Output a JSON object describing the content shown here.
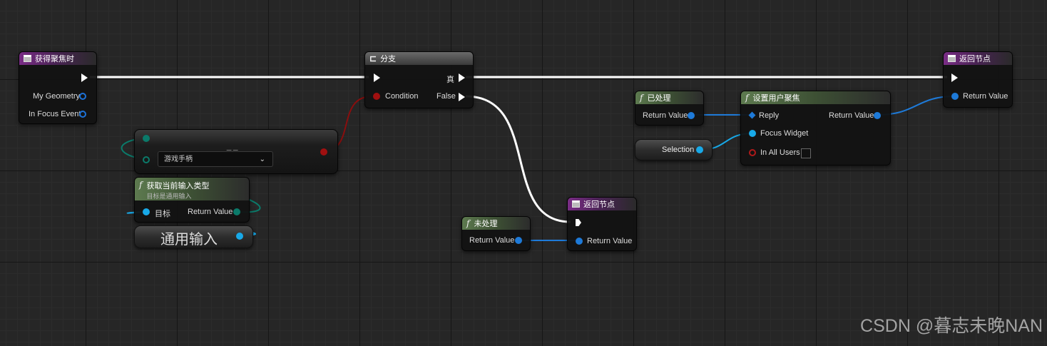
{
  "nodes": {
    "on_focus_received": {
      "title": "获得聚焦时",
      "pins": {
        "geometry": "My Geometry",
        "focus_event": "In Focus Event"
      }
    },
    "branch": {
      "title": "分支",
      "pins": {
        "condition": "Condition",
        "true": "真",
        "false": "False"
      }
    },
    "equal": {
      "symbol": "==",
      "dropdown_value": "游戏手柄"
    },
    "get_input_type": {
      "title": "获取当前输入类型",
      "subtitle": "目标是通用输入",
      "pins": {
        "target": "目标",
        "return": "Return Value"
      }
    },
    "common_input": {
      "label": "通用输入"
    },
    "unhandled": {
      "title": "未处理",
      "pins": {
        "return": "Return Value"
      }
    },
    "return_mid": {
      "title": "返回节点",
      "pins": {
        "return": "Return Value"
      }
    },
    "handled": {
      "title": "已处理",
      "pins": {
        "return": "Return Value"
      }
    },
    "selection": {
      "label": "Selection"
    },
    "set_user_focus": {
      "title": "设置用户聚焦",
      "pins": {
        "reply": "Reply",
        "focus_widget": "Focus Widget",
        "in_all_users": "In All Users",
        "return": "Return Value"
      },
      "in_all_users_checked": false
    },
    "return_right": {
      "title": "返回节点",
      "pins": {
        "return": "Return Value"
      }
    }
  },
  "watermark": "CSDN @暮志未晚NAN",
  "colors": {
    "event_header": "#7a2d86",
    "function_header": "#5d7a4f",
    "struct_pin": "#1e7ad8",
    "object_pin": "#18a9e8",
    "bool_pin": "#a01010",
    "enum_pin": "#0b7a6a",
    "exec_wire": "#ffffff"
  }
}
